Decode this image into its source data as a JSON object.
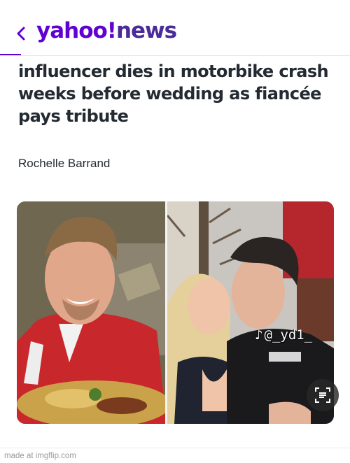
{
  "header": {
    "back_icon": "chevron-left-icon",
    "brand": "yahoo!",
    "section": "news"
  },
  "article": {
    "headline": "influencer dies in motorbike crash weeks before wedding as fiancée pays tribute",
    "author": "Rochelle Barrand"
  },
  "photo": {
    "watermark": "@_yd1_",
    "watermark_icon": "tiktok-icon",
    "lens_icon": "visual-search-icon"
  },
  "footer": {
    "credit": "made at imgflip.com"
  },
  "colors": {
    "brand_purple": "#6001d2",
    "headline_text": "#232a31"
  }
}
